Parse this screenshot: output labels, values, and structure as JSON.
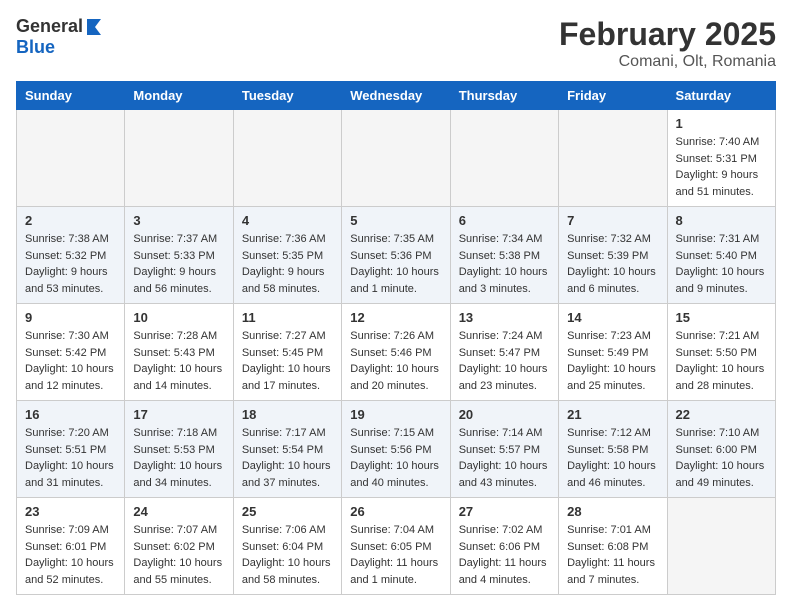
{
  "logo": {
    "general": "General",
    "blue": "Blue"
  },
  "title": "February 2025",
  "subtitle": "Comani, Olt, Romania",
  "days_of_week": [
    "Sunday",
    "Monday",
    "Tuesday",
    "Wednesday",
    "Thursday",
    "Friday",
    "Saturday"
  ],
  "weeks": [
    [
      {
        "day": "",
        "info": ""
      },
      {
        "day": "",
        "info": ""
      },
      {
        "day": "",
        "info": ""
      },
      {
        "day": "",
        "info": ""
      },
      {
        "day": "",
        "info": ""
      },
      {
        "day": "",
        "info": ""
      },
      {
        "day": "1",
        "info": "Sunrise: 7:40 AM\nSunset: 5:31 PM\nDaylight: 9 hours\nand 51 minutes."
      }
    ],
    [
      {
        "day": "2",
        "info": "Sunrise: 7:38 AM\nSunset: 5:32 PM\nDaylight: 9 hours\nand 53 minutes."
      },
      {
        "day": "3",
        "info": "Sunrise: 7:37 AM\nSunset: 5:33 PM\nDaylight: 9 hours\nand 56 minutes."
      },
      {
        "day": "4",
        "info": "Sunrise: 7:36 AM\nSunset: 5:35 PM\nDaylight: 9 hours\nand 58 minutes."
      },
      {
        "day": "5",
        "info": "Sunrise: 7:35 AM\nSunset: 5:36 PM\nDaylight: 10 hours\nand 1 minute."
      },
      {
        "day": "6",
        "info": "Sunrise: 7:34 AM\nSunset: 5:38 PM\nDaylight: 10 hours\nand 3 minutes."
      },
      {
        "day": "7",
        "info": "Sunrise: 7:32 AM\nSunset: 5:39 PM\nDaylight: 10 hours\nand 6 minutes."
      },
      {
        "day": "8",
        "info": "Sunrise: 7:31 AM\nSunset: 5:40 PM\nDaylight: 10 hours\nand 9 minutes."
      }
    ],
    [
      {
        "day": "9",
        "info": "Sunrise: 7:30 AM\nSunset: 5:42 PM\nDaylight: 10 hours\nand 12 minutes."
      },
      {
        "day": "10",
        "info": "Sunrise: 7:28 AM\nSunset: 5:43 PM\nDaylight: 10 hours\nand 14 minutes."
      },
      {
        "day": "11",
        "info": "Sunrise: 7:27 AM\nSunset: 5:45 PM\nDaylight: 10 hours\nand 17 minutes."
      },
      {
        "day": "12",
        "info": "Sunrise: 7:26 AM\nSunset: 5:46 PM\nDaylight: 10 hours\nand 20 minutes."
      },
      {
        "day": "13",
        "info": "Sunrise: 7:24 AM\nSunset: 5:47 PM\nDaylight: 10 hours\nand 23 minutes."
      },
      {
        "day": "14",
        "info": "Sunrise: 7:23 AM\nSunset: 5:49 PM\nDaylight: 10 hours\nand 25 minutes."
      },
      {
        "day": "15",
        "info": "Sunrise: 7:21 AM\nSunset: 5:50 PM\nDaylight: 10 hours\nand 28 minutes."
      }
    ],
    [
      {
        "day": "16",
        "info": "Sunrise: 7:20 AM\nSunset: 5:51 PM\nDaylight: 10 hours\nand 31 minutes."
      },
      {
        "day": "17",
        "info": "Sunrise: 7:18 AM\nSunset: 5:53 PM\nDaylight: 10 hours\nand 34 minutes."
      },
      {
        "day": "18",
        "info": "Sunrise: 7:17 AM\nSunset: 5:54 PM\nDaylight: 10 hours\nand 37 minutes."
      },
      {
        "day": "19",
        "info": "Sunrise: 7:15 AM\nSunset: 5:56 PM\nDaylight: 10 hours\nand 40 minutes."
      },
      {
        "day": "20",
        "info": "Sunrise: 7:14 AM\nSunset: 5:57 PM\nDaylight: 10 hours\nand 43 minutes."
      },
      {
        "day": "21",
        "info": "Sunrise: 7:12 AM\nSunset: 5:58 PM\nDaylight: 10 hours\nand 46 minutes."
      },
      {
        "day": "22",
        "info": "Sunrise: 7:10 AM\nSunset: 6:00 PM\nDaylight: 10 hours\nand 49 minutes."
      }
    ],
    [
      {
        "day": "23",
        "info": "Sunrise: 7:09 AM\nSunset: 6:01 PM\nDaylight: 10 hours\nand 52 minutes."
      },
      {
        "day": "24",
        "info": "Sunrise: 7:07 AM\nSunset: 6:02 PM\nDaylight: 10 hours\nand 55 minutes."
      },
      {
        "day": "25",
        "info": "Sunrise: 7:06 AM\nSunset: 6:04 PM\nDaylight: 10 hours\nand 58 minutes."
      },
      {
        "day": "26",
        "info": "Sunrise: 7:04 AM\nSunset: 6:05 PM\nDaylight: 11 hours\nand 1 minute."
      },
      {
        "day": "27",
        "info": "Sunrise: 7:02 AM\nSunset: 6:06 PM\nDaylight: 11 hours\nand 4 minutes."
      },
      {
        "day": "28",
        "info": "Sunrise: 7:01 AM\nSunset: 6:08 PM\nDaylight: 11 hours\nand 7 minutes."
      },
      {
        "day": "",
        "info": ""
      }
    ]
  ]
}
